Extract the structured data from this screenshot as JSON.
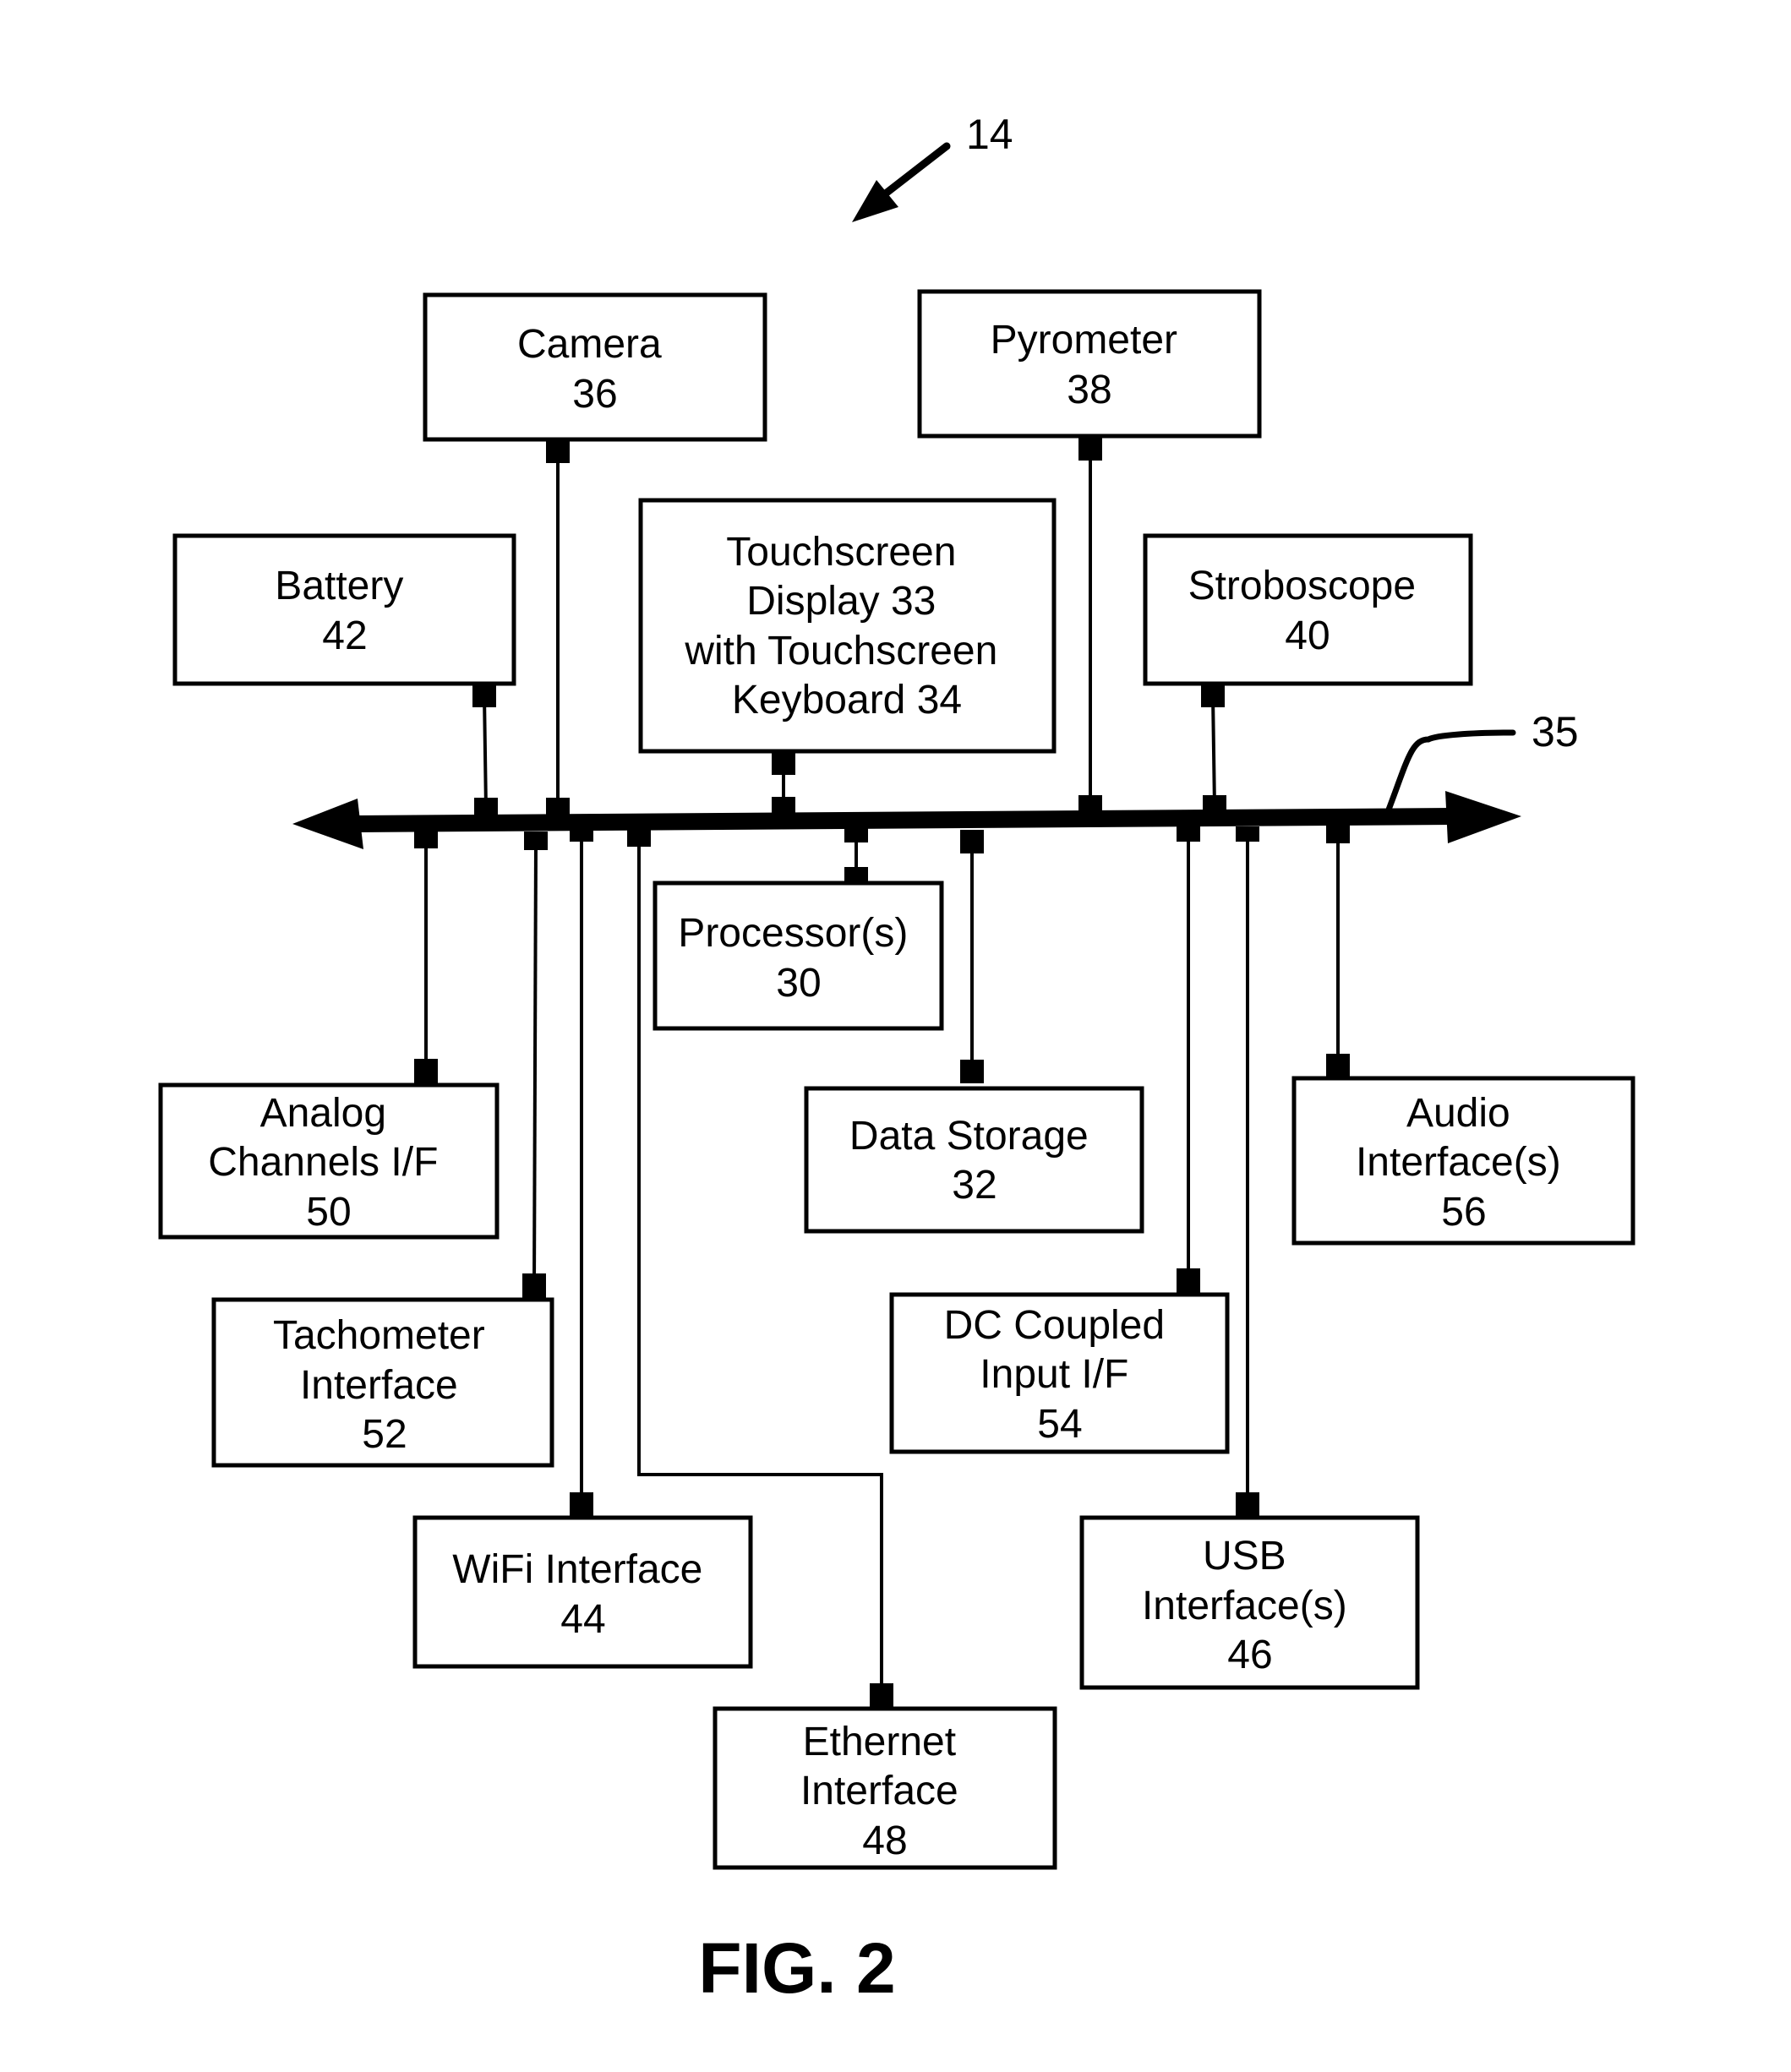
{
  "figure": {
    "caption": "FIG. 2",
    "device_ref": "14",
    "bus_ref": "35"
  },
  "blocks": {
    "camera": {
      "lines": [
        "Camera",
        "36"
      ]
    },
    "pyrometer": {
      "lines": [
        "Pyrometer",
        "38"
      ]
    },
    "touchscreen": {
      "lines": [
        "Touchscreen",
        "Display 33",
        "with Touchscreen",
        "Keyboard 34"
      ]
    },
    "battery": {
      "lines": [
        "Battery",
        "42"
      ]
    },
    "stroboscope": {
      "lines": [
        "Stroboscope",
        "40"
      ]
    },
    "processor": {
      "lines": [
        "Processor(s)",
        "30"
      ]
    },
    "data_storage": {
      "lines": [
        "Data Storage",
        "32"
      ]
    },
    "analog": {
      "lines": [
        "Analog",
        "Channels I/F",
        "50"
      ]
    },
    "audio": {
      "lines": [
        "Audio",
        "Interface(s)",
        "56"
      ]
    },
    "tachometer": {
      "lines": [
        "Tachometer",
        "Interface",
        "52"
      ]
    },
    "dc_coupled": {
      "lines": [
        "DC Coupled",
        "Input I/F",
        "54"
      ]
    },
    "wifi": {
      "lines": [
        "WiFi Interface",
        "44"
      ]
    },
    "usb": {
      "lines": [
        "USB",
        "Interface(s)",
        "46"
      ]
    },
    "ethernet": {
      "lines": [
        "Ethernet",
        "Interface",
        "48"
      ]
    }
  },
  "connections": [
    {
      "from": "camera",
      "to": "bus"
    },
    {
      "from": "pyrometer",
      "to": "bus"
    },
    {
      "from": "touchscreen",
      "to": "bus"
    },
    {
      "from": "battery",
      "to": "bus"
    },
    {
      "from": "stroboscope",
      "to": "bus"
    },
    {
      "from": "processor",
      "to": "bus"
    },
    {
      "from": "data_storage",
      "to": "bus"
    },
    {
      "from": "analog",
      "to": "bus"
    },
    {
      "from": "audio",
      "to": "bus"
    },
    {
      "from": "tachometer",
      "to": "bus"
    },
    {
      "from": "dc_coupled",
      "to": "bus"
    },
    {
      "from": "wifi",
      "to": "bus"
    },
    {
      "from": "usb",
      "to": "bus"
    },
    {
      "from": "ethernet",
      "to": "bus"
    }
  ]
}
